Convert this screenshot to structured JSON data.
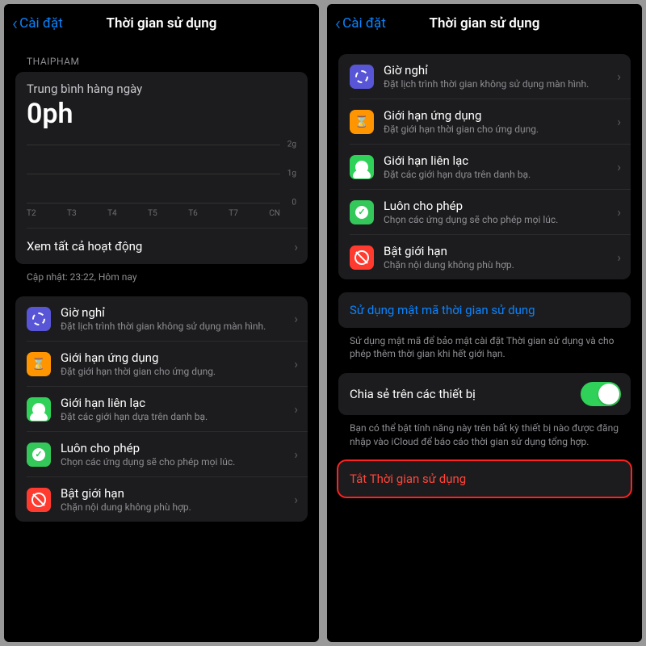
{
  "left": {
    "back": "Cài đặt",
    "title": "Thời gian sử dụng",
    "owner_label": "THAIPHAM",
    "avg_label": "Trung bình hàng ngày",
    "avg_value": "0ph",
    "ylabels": [
      "2g",
      "1g",
      "0"
    ],
    "xlabels": [
      "T2",
      "T3",
      "T4",
      "T5",
      "T6",
      "T7",
      "CN"
    ],
    "see_all": "Xem tất cả hoạt động",
    "updated": "Cập nhật: 23:22, Hôm nay",
    "items": [
      {
        "title": "Giờ nghỉ",
        "sub": "Đặt lịch trình thời gian không sử dụng màn hình."
      },
      {
        "title": "Giới hạn ứng dụng",
        "sub": "Đặt giới hạn thời gian cho ứng dụng."
      },
      {
        "title": "Giới hạn liên lạc",
        "sub": "Đặt các giới hạn dựa trên danh bạ."
      },
      {
        "title": "Luôn cho phép",
        "sub": "Chọn các ứng dụng sẽ cho phép mọi lúc."
      },
      {
        "title": "Bật giới hạn",
        "sub": "Chặn nội dung không phù hợp."
      }
    ]
  },
  "right": {
    "back": "Cài đặt",
    "title": "Thời gian sử dụng",
    "items": [
      {
        "title": "Giờ nghỉ",
        "sub": "Đặt lịch trình thời gian không sử dụng màn hình."
      },
      {
        "title": "Giới hạn ứng dụng",
        "sub": "Đặt giới hạn thời gian cho ứng dụng."
      },
      {
        "title": "Giới hạn liên lạc",
        "sub": "Đặt các giới hạn dựa trên danh bạ."
      },
      {
        "title": "Luôn cho phép",
        "sub": "Chọn các ứng dụng sẽ cho phép mọi lúc."
      },
      {
        "title": "Bật giới hạn",
        "sub": "Chặn nội dung không phù hợp."
      }
    ],
    "passcode": "Sử dụng mật mã thời gian sử dụng",
    "passcode_note": "Sử dụng mật mã để bảo mật cài đặt Thời gian sử dụng và cho phép thêm thời gian khi hết giới hạn.",
    "share_label": "Chia sẻ trên các thiết bị",
    "share_note": "Bạn có thể bật tính năng này trên bất kỳ thiết bị nào được đăng nhập vào iCloud để báo cáo thời gian sử dụng tổng hợp.",
    "turn_off": "Tắt Thời gian sử dụng"
  },
  "chart_data": {
    "type": "bar",
    "categories": [
      "T2",
      "T3",
      "T4",
      "T5",
      "T6",
      "T7",
      "CN"
    ],
    "values": [
      0,
      0,
      0,
      0,
      0,
      0,
      0
    ],
    "ylabel_unit": "g",
    "ylim": [
      0,
      2
    ],
    "title": "Trung bình hàng ngày",
    "summary_value": "0ph"
  }
}
